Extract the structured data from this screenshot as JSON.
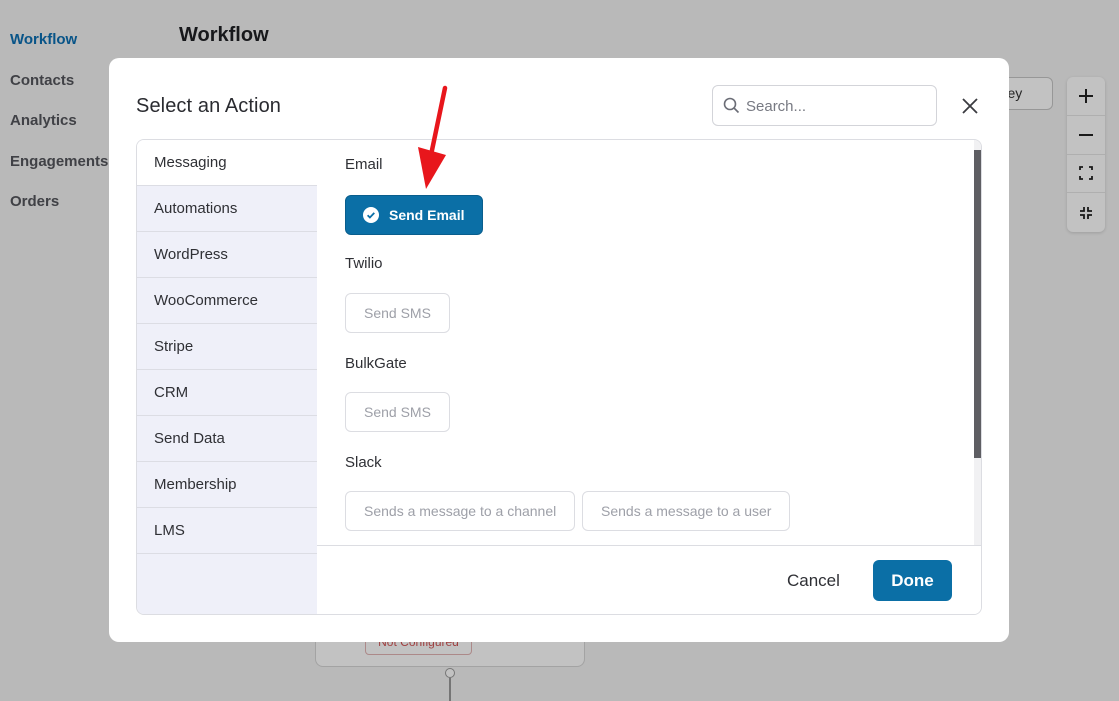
{
  "background": {
    "nav": [
      "Workflow",
      "Contacts",
      "Analytics",
      "Engagements",
      "Orders"
    ],
    "title": "Workflow",
    "journey_button": "rney",
    "status_badge": "Not Configured",
    "zoom_controls": [
      "plus-icon",
      "minus-icon",
      "fit-screen-icon",
      "fullscreen-icon"
    ]
  },
  "modal": {
    "title": "Select an Action",
    "search_placeholder": "Search...",
    "categories": [
      "Messaging",
      "Automations",
      "WordPress",
      "WooCommerce",
      "Stripe",
      "CRM",
      "Send Data",
      "Membership",
      "LMS"
    ],
    "active_category": "Messaging",
    "groups": [
      {
        "label": "Email",
        "actions": [
          "Send Email"
        ]
      },
      {
        "label": "Twilio",
        "actions": [
          "Send SMS"
        ]
      },
      {
        "label": "BulkGate",
        "actions": [
          "Send SMS"
        ]
      },
      {
        "label": "Slack",
        "actions": [
          "Sends a message to a channel",
          "Sends a message to a user"
        ]
      }
    ],
    "selected_action": "Send Email",
    "cancel_label": "Cancel",
    "done_label": "Done"
  },
  "colors": {
    "primary": "#0b6fa6",
    "annotation_arrow": "#e8161c",
    "sidebar_bg": "#eff0f9"
  }
}
